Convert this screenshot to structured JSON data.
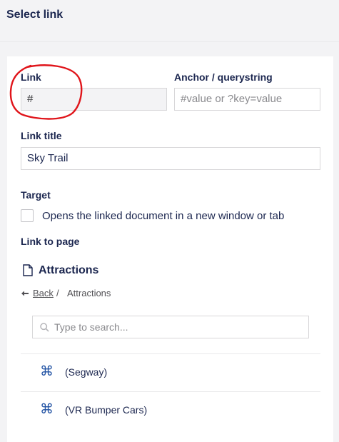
{
  "header": {
    "title": "Select link"
  },
  "form": {
    "link": {
      "label": "Link",
      "value": "#"
    },
    "anchor": {
      "label": "Anchor / querystring",
      "placeholder": "#value or ?key=value"
    },
    "link_title": {
      "label": "Link title",
      "value": "Sky Trail"
    },
    "target": {
      "label": "Target",
      "checkbox_label": "Opens the linked document in a new window or tab",
      "checked": false
    },
    "link_to_page": {
      "label": "Link to page"
    }
  },
  "tree": {
    "current_node": "Attractions",
    "breadcrumb": {
      "back": "Back",
      "separator": "/",
      "current": "Attractions"
    },
    "search_placeholder": "Type to search...",
    "items": [
      {
        "label": "(Segway)",
        "icon": "command-icon"
      },
      {
        "label": "(VR Bumper Cars)",
        "icon": "command-icon"
      }
    ]
  },
  "colors": {
    "annotation_circle": "#e0151b",
    "item_icon": "#2152a3"
  }
}
